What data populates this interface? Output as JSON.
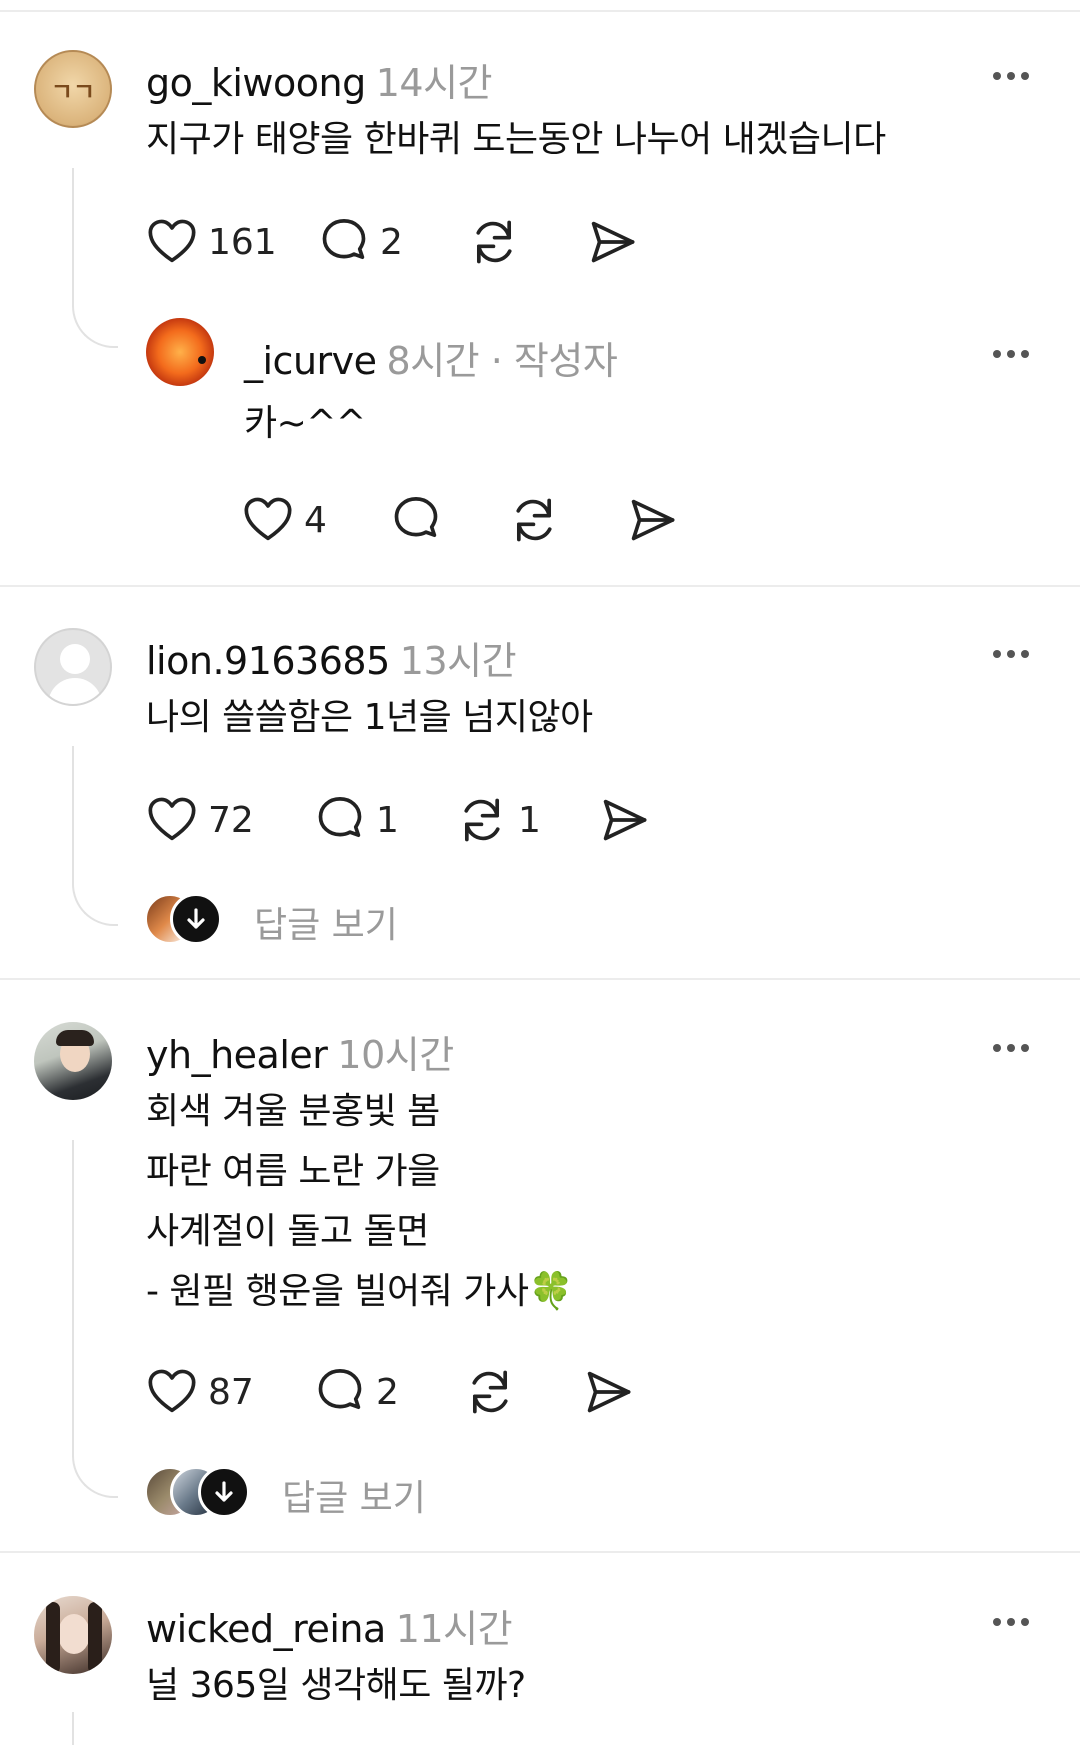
{
  "posts": [
    {
      "username": "go_kiwoong",
      "time": "14시간",
      "text_lines": [
        "지구가 태양을 한바퀴 도는동안 나누어 내겠습니다"
      ],
      "likes": "161",
      "comments": "2",
      "reposts": "",
      "avatar_text": "ㄱㄱ",
      "reply": {
        "username": "_icurve",
        "time": "8시간",
        "author_tag": "· 작성자",
        "text": "카~^^",
        "likes": "4",
        "comments": "",
        "reposts": ""
      }
    },
    {
      "username": "lion.9163685",
      "time": "13시간",
      "text_lines": [
        "나의 쓸쓸함은 1년을 넘지않아"
      ],
      "likes": "72",
      "comments": "1",
      "reposts": "1",
      "view_replies": "답글 보기"
    },
    {
      "username": "yh_healer",
      "time": "10시간",
      "text_lines": [
        "회색 겨울 분홍빛 봄",
        "파란 여름 노란 가을",
        "사계절이 돌고 돌면",
        "- 원필 행운을 빌어줘 가사🍀"
      ],
      "likes": "87",
      "comments": "2",
      "reposts": "",
      "view_replies": "답글 보기"
    },
    {
      "username": "wicked_reina",
      "time": "11시간",
      "text_lines": [
        "널 365일 생각해도 될까?"
      ]
    }
  ],
  "icons": {
    "like": "heart-icon",
    "comment": "comment-bubble-icon",
    "repost": "repost-icon",
    "share": "send-icon",
    "more": "more-dots-icon"
  }
}
